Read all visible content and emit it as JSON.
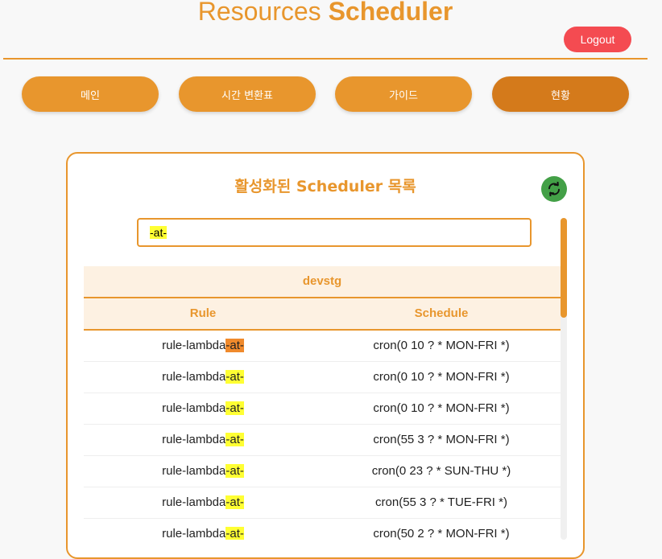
{
  "header": {
    "title_prefix": "Resources",
    "title_bold": "Scheduler",
    "logout_label": "Logout"
  },
  "nav": {
    "items": [
      {
        "label": "메인"
      },
      {
        "label": "시간 변환표"
      },
      {
        "label": "가이드"
      },
      {
        "label": "현황"
      }
    ],
    "active": "현황"
  },
  "panel": {
    "title": "활성화된 Scheduler 목록",
    "refresh_icon": "refresh-icon",
    "search_value": "-at-",
    "group": "devstg",
    "columns": {
      "rule": "Rule",
      "schedule": "Schedule"
    },
    "rows": [
      {
        "rule_prefix": "rule-lambda",
        "rule_match": "-at-",
        "schedule": "cron(0 10 ? * MON-FRI *)",
        "current": true
      },
      {
        "rule_prefix": "rule-lambda",
        "rule_match": "-at-",
        "schedule": "cron(0 10 ? * MON-FRI *)",
        "current": false
      },
      {
        "rule_prefix": "rule-lambda",
        "rule_match": "-at-",
        "schedule": "cron(0 10 ? * MON-FRI *)",
        "current": false
      },
      {
        "rule_prefix": "rule-lambda",
        "rule_match": "-at-",
        "schedule": "cron(55 3 ? * MON-FRI *)",
        "current": false
      },
      {
        "rule_prefix": "rule-lambda",
        "rule_match": "-at-",
        "schedule": "cron(0 23 ? * SUN-THU *)",
        "current": false
      },
      {
        "rule_prefix": "rule-lambda",
        "rule_match": "-at-",
        "schedule": "cron(55 3 ? * TUE-FRI *)",
        "current": false
      },
      {
        "rule_prefix": "rule-lambda",
        "rule_match": "-at-",
        "schedule": "cron(50 2 ? * MON-FRI *)",
        "current": false
      }
    ]
  },
  "colors": {
    "accent": "#e8962d",
    "active_nav": "#d47a1b",
    "logout": "#f44b51",
    "refresh": "#43a047",
    "highlight": "#ffff33",
    "current_highlight": "#f08a2c"
  }
}
